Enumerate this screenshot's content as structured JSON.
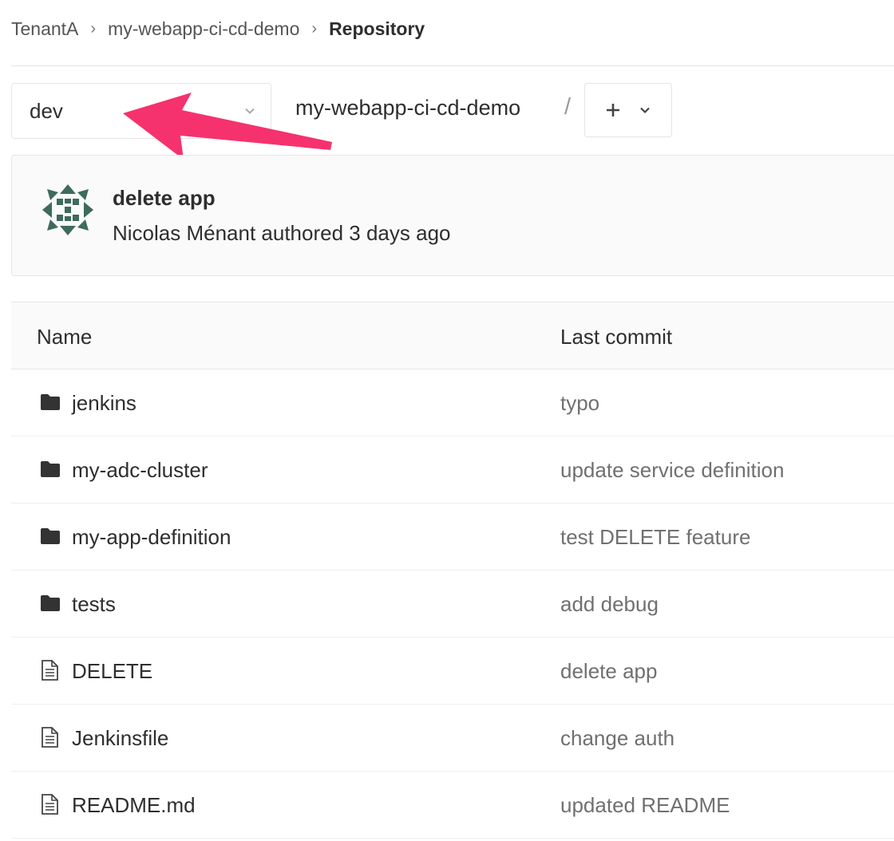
{
  "breadcrumb": {
    "items": [
      "TenantA",
      "my-webapp-ci-cd-demo"
    ],
    "current": "Repository",
    "separator": "›"
  },
  "tree": {
    "branch": "dev",
    "path": "my-webapp-ci-cd-demo",
    "path_separator": "/",
    "add_icon": "plus-icon",
    "dropdown_icon": "chevron-down-icon"
  },
  "last_commit": {
    "title": "delete app",
    "meta": "Nicolas Ménant authored 3 days ago",
    "avatar_icon": "identicon-avatar"
  },
  "table": {
    "headers": {
      "name": "Name",
      "last_commit": "Last commit"
    },
    "rows": [
      {
        "name": "jenkins",
        "type": "folder",
        "commit": "typo"
      },
      {
        "name": "my-adc-cluster",
        "type": "folder",
        "commit": "update service definition"
      },
      {
        "name": "my-app-definition",
        "type": "folder",
        "commit": "test DELETE feature"
      },
      {
        "name": "tests",
        "type": "folder",
        "commit": "add debug"
      },
      {
        "name": "DELETE",
        "type": "file",
        "commit": "delete app"
      },
      {
        "name": "Jenkinsfile",
        "type": "file",
        "commit": "change auth"
      },
      {
        "name": "README.md",
        "type": "file",
        "commit": "updated README"
      }
    ]
  },
  "colors": {
    "annotation_arrow": "#f5326d",
    "avatar": "#3e6b5a",
    "commit_box_bg": "#fafafa",
    "border": "#e5e5e5"
  }
}
